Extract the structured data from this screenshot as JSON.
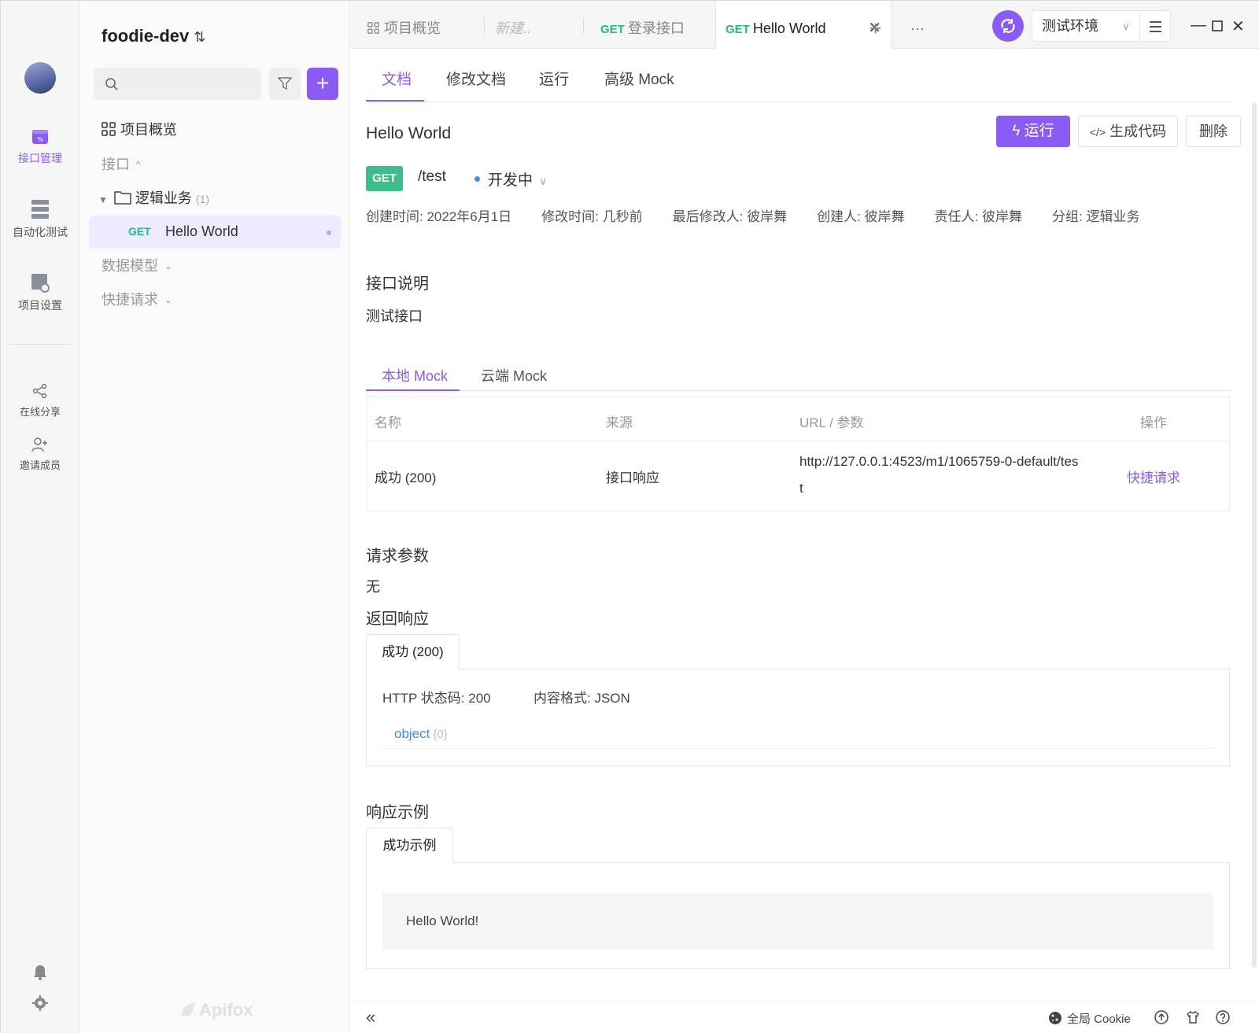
{
  "app": {
    "brand": "Apifox"
  },
  "rail": {
    "items": [
      {
        "label": "接口管理",
        "active": true
      },
      {
        "label": "自动化测试"
      },
      {
        "label": "项目设置"
      }
    ],
    "secondary": [
      {
        "label": "在线分享"
      },
      {
        "label": "邀请成员"
      }
    ]
  },
  "sidebar": {
    "project_name": "foodie-dev",
    "search_placeholder": "",
    "overview_label": "项目概览",
    "interfaces_label": "接口",
    "folder_name": "逻辑业务",
    "folder_count": "(1)",
    "item_method": "GET",
    "item_name": "Hello World",
    "data_models_label": "数据模型",
    "quick_requests_label": "快捷请求"
  },
  "tabs": [
    {
      "label": "项目概览"
    },
    {
      "label": "新建.."
    },
    {
      "method": "GET",
      "label": "登录接口"
    },
    {
      "method": "GET",
      "label": "Hello World",
      "active": true
    }
  ],
  "env": {
    "selected": "测试环境"
  },
  "subtabs": [
    "文档",
    "修改文档",
    "运行",
    "高级 Mock"
  ],
  "doc": {
    "title": "Hello World",
    "run_label": "运行",
    "gen_code_label": "生成代码",
    "delete_label": "删除",
    "method": "GET",
    "path": "/test",
    "status": "开发中",
    "meta": {
      "created": "创建时间: 2022年6月1日",
      "modified": "修改时间: 几秒前",
      "last_modifier": "最后修改人: 彼岸舞",
      "creator": "创建人: 彼岸舞",
      "owner": "责任人: 彼岸舞",
      "group": "分组: 逻辑业务"
    },
    "desc_heading": "接口说明",
    "desc_text": "测试接口",
    "mock_tabs": [
      "本地 Mock",
      "云端 Mock"
    ],
    "mock_table": {
      "headers": [
        "名称",
        "来源",
        "URL / 参数",
        "操作"
      ],
      "row": {
        "name": "成功 (200)",
        "source": "接口响应",
        "url_line1": "http://127.0.0.1:4523/m1/1065759-0-default/tes",
        "url_line2": "t",
        "action": "快捷请求"
      }
    },
    "params_heading": "请求参数",
    "params_text": "无",
    "response_heading": "返回响应",
    "response_tab": "成功 (200)",
    "http_status": "HTTP 状态码: 200",
    "content_type": "内容格式: JSON",
    "schema_type": "object",
    "schema_count": "{0}",
    "example_heading": "响应示例",
    "example_tab": "成功示例",
    "example_body": "Hello World!"
  },
  "bottom": {
    "cookie_label": "全局 Cookie"
  },
  "colors": {
    "accent": "#8a5cf5",
    "get": "#1ebd83",
    "link": "#3b8ff5"
  }
}
